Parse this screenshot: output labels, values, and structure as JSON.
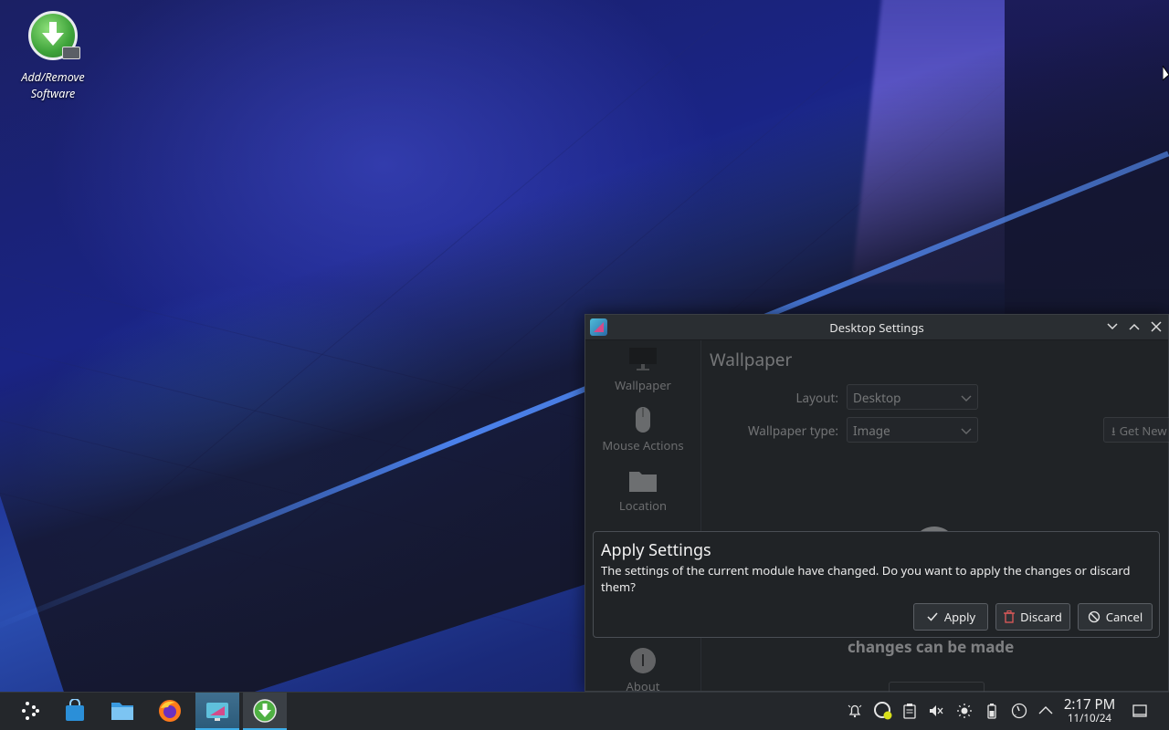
{
  "desktop": {
    "icon_label": "Add/Remove Software"
  },
  "window": {
    "title": "Desktop Settings",
    "sidebar": {
      "items": [
        {
          "label": "Wallpaper",
          "icon": "monitor-icon"
        },
        {
          "label": "Mouse Actions",
          "icon": "mouse-icon"
        },
        {
          "label": "Location",
          "icon": "folder-icon"
        },
        {
          "label": "About",
          "icon": "info-icon"
        }
      ]
    },
    "main": {
      "heading": "Wallpaper",
      "layout_label": "Layout:",
      "layout_value": "Desktop",
      "wallpaper_type_label": "Wallpaper type:",
      "wallpaper_type_value": "Image",
      "get_plugins_label": "Get New Plugins...",
      "background_text": "changes can be made"
    }
  },
  "dialog": {
    "title": "Apply Settings",
    "message": "The settings of the current module have changed. Do you want to apply the changes or discard them?",
    "apply_label": "Apply",
    "discard_label": "Discard",
    "cancel_label": "Cancel"
  },
  "taskbar": {
    "clock_time": "2:17 PM",
    "clock_date": "11/10/24",
    "accent_color": "#3daee9"
  }
}
